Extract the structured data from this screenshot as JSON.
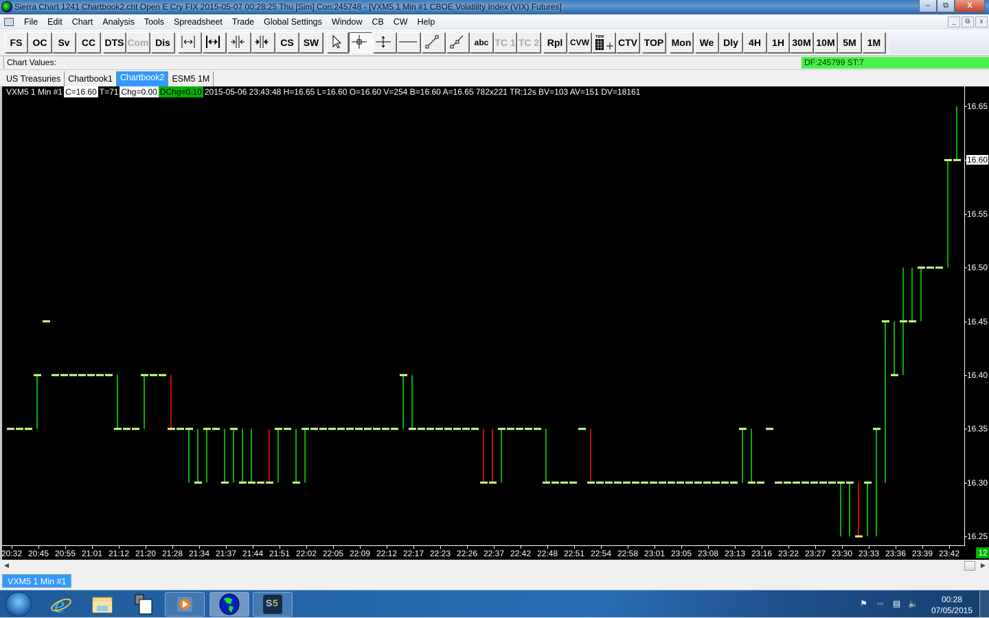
{
  "window": {
    "title": "Sierra Chart 1241 Chartbook2.cht  Open E Cry FIX 2015-05-07  00:28:25 Thu [Sim]  Con:245748 - [VXM5  1 Min   #1  CBOE Volatility Index (VIX) Futures]",
    "minimize": "–",
    "maximize": "⧉",
    "close": "X"
  },
  "menu": [
    "File",
    "Edit",
    "Chart",
    "Analysis",
    "Tools",
    "Spreadsheet",
    "Trade",
    "Global Settings",
    "Window",
    "CB",
    "CW",
    "Help"
  ],
  "mdi": {
    "minimize": "_",
    "restore": "⧉",
    "close": "x"
  },
  "toolbar": {
    "buttons": [
      {
        "label": "FS"
      },
      {
        "label": "OC"
      },
      {
        "label": "Sv"
      },
      {
        "label": "CC"
      },
      {
        "label": "DTS"
      },
      {
        "label": "Com",
        "disabled": true
      },
      {
        "label": "Dis"
      },
      {
        "icon": "scale-left-icon"
      },
      {
        "icon": "scale-both-icon"
      },
      {
        "icon": "compress-in-icon"
      },
      {
        "icon": "compress-out-icon"
      },
      {
        "label": "CS"
      },
      {
        "label": "SW"
      },
      {
        "icon": "pointer-icon"
      },
      {
        "icon": "crosshair-icon",
        "pressed": true
      },
      {
        "icon": "value-tool-icon"
      },
      {
        "icon": "horizontal-line-icon"
      },
      {
        "icon": "line-tool-icon"
      },
      {
        "icon": "ray-tool-icon"
      },
      {
        "label": "abc",
        "small": true
      },
      {
        "label": "TC 1",
        "disabled": true
      },
      {
        "label": "TC 2",
        "disabled": true
      },
      {
        "label": "Rpl"
      },
      {
        "label": "CVW",
        "small": true
      },
      {
        "icon": "trade-window-icon"
      },
      {
        "label": "CTV"
      },
      {
        "label": "TOP"
      },
      {
        "label": "Mon"
      },
      {
        "label": "We"
      },
      {
        "label": "Dly"
      },
      {
        "label": "4H"
      },
      {
        "label": "1H"
      },
      {
        "label": "30M"
      },
      {
        "label": "10M"
      },
      {
        "label": "5M"
      },
      {
        "label": "1M"
      }
    ]
  },
  "chart_values": {
    "label": "Chart Values:",
    "status": "DF:245799  ST:7",
    "status_color": "#4af04a"
  },
  "tabs": [
    {
      "label": "US Treasuries"
    },
    {
      "label": "Chartbook1"
    },
    {
      "label": "Chartbook2",
      "active": true
    },
    {
      "label": "ESM5 1M"
    }
  ],
  "info": {
    "symbol": "VXM5  1 Min   #1",
    "close": "C=16.60",
    "ticks": "T=71",
    "chg": "Chg=0.00",
    "dchg": "DChg=0.10",
    "details": "2015-05-06 23:43:48 H=16.65 L=16.60 O=16.60 V=254 B=16.60 A=16.65 782x221 TR:12s BV=103 AV=151 DV=18161"
  },
  "chart_data": {
    "type": "line",
    "style": "stair-step close line with high/low connectors",
    "colors": {
      "close": "#ccff88",
      "up": "#00ee00",
      "down": "#ff1010",
      "background": "#000000"
    },
    "ylim": [
      16.25,
      16.65
    ],
    "yticks": [
      "16.65",
      "16.60",
      "16.55",
      "16.50",
      "16.45",
      "16.40",
      "16.35",
      "16.30",
      "16.25"
    ],
    "current_price": "16.60",
    "xticks": [
      "20:32",
      "20:45",
      "20:55",
      "21:01",
      "21:12",
      "21:20",
      "21:28",
      "21:34",
      "21:37",
      "21:44",
      "21:51",
      "22:02",
      "22:05",
      "22:09",
      "22:12",
      "22:17",
      "22:23",
      "22:26",
      "22:37",
      "22:42",
      "22:48",
      "22:51",
      "22:54",
      "22:58",
      "23:01",
      "23:05",
      "23:08",
      "23:13",
      "23:16",
      "23:22",
      "23:27",
      "23:30",
      "23:33",
      "23:36",
      "23:39",
      "23:42"
    ],
    "bars": [
      {
        "c": 16.35
      },
      {
        "c": 16.35
      },
      {
        "c": 16.35
      },
      {
        "c": 16.4
      },
      {
        "c": 16.45,
        "nc": true
      },
      {
        "c": 16.4,
        "nc": true
      },
      {
        "c": 16.4
      },
      {
        "c": 16.4
      },
      {
        "c": 16.4
      },
      {
        "c": 16.4
      },
      {
        "c": 16.4
      },
      {
        "c": 16.4
      },
      {
        "c": 16.35
      },
      {
        "c": 16.35
      },
      {
        "c": 16.35
      },
      {
        "c": 16.4
      },
      {
        "c": 16.4
      },
      {
        "c": 16.4
      },
      {
        "c": 16.35,
        "down": true
      },
      {
        "c": 16.35
      },
      {
        "c": 16.35,
        "l": 16.3
      },
      {
        "c": 16.3
      },
      {
        "c": 16.35
      },
      {
        "c": 16.35
      },
      {
        "c": 16.3
      },
      {
        "c": 16.35
      },
      {
        "c": 16.3
      },
      {
        "c": 16.3,
        "h": 16.35
      },
      {
        "c": 16.3
      },
      {
        "c": 16.3,
        "h": 16.35,
        "down": true
      },
      {
        "c": 16.35
      },
      {
        "c": 16.35
      },
      {
        "c": 16.3
      },
      {
        "c": 16.35
      },
      {
        "c": 16.35
      },
      {
        "c": 16.35
      },
      {
        "c": 16.35
      },
      {
        "c": 16.35
      },
      {
        "c": 16.35
      },
      {
        "c": 16.35
      },
      {
        "c": 16.35
      },
      {
        "c": 16.35
      },
      {
        "c": 16.35
      },
      {
        "c": 16.35
      },
      {
        "c": 16.4
      },
      {
        "c": 16.35
      },
      {
        "c": 16.35
      },
      {
        "c": 16.35
      },
      {
        "c": 16.35
      },
      {
        "c": 16.35
      },
      {
        "c": 16.35
      },
      {
        "c": 16.35
      },
      {
        "c": 16.35
      },
      {
        "c": 16.3,
        "down": true
      },
      {
        "c": 16.3,
        "h": 16.35,
        "down": true
      },
      {
        "c": 16.35
      },
      {
        "c": 16.35
      },
      {
        "c": 16.35
      },
      {
        "c": 16.35
      },
      {
        "c": 16.35
      },
      {
        "c": 16.3
      },
      {
        "c": 16.3
      },
      {
        "c": 16.3
      },
      {
        "c": 16.3
      },
      {
        "c": 16.35,
        "nc": true
      },
      {
        "c": 16.3,
        "down": true
      },
      {
        "c": 16.3
      },
      {
        "c": 16.3
      },
      {
        "c": 16.3
      },
      {
        "c": 16.3
      },
      {
        "c": 16.3
      },
      {
        "c": 16.3
      },
      {
        "c": 16.3
      },
      {
        "c": 16.3
      },
      {
        "c": 16.3
      },
      {
        "c": 16.3
      },
      {
        "c": 16.3
      },
      {
        "c": 16.3
      },
      {
        "c": 16.3
      },
      {
        "c": 16.3
      },
      {
        "c": 16.3
      },
      {
        "c": 16.3
      },
      {
        "c": 16.35
      },
      {
        "c": 16.3
      },
      {
        "c": 16.3
      },
      {
        "c": 16.35,
        "nc": true
      },
      {
        "c": 16.3,
        "nc": true
      },
      {
        "c": 16.3
      },
      {
        "c": 16.3
      },
      {
        "c": 16.3
      },
      {
        "c": 16.3
      },
      {
        "c": 16.3
      },
      {
        "c": 16.3
      },
      {
        "c": 16.3,
        "l": 16.25
      },
      {
        "c": 16.3,
        "l": 16.25
      },
      {
        "c": 16.25,
        "down": true
      },
      {
        "c": 16.3
      },
      {
        "c": 16.35,
        "l": 16.25
      },
      {
        "c": 16.45,
        "l": 16.3
      },
      {
        "c": 16.4,
        "h": 16.45
      },
      {
        "c": 16.45,
        "l": 16.4,
        "h": 16.5
      },
      {
        "c": 16.45,
        "h": 16.5
      },
      {
        "c": 16.5
      },
      {
        "c": 16.5
      },
      {
        "c": 16.5
      },
      {
        "c": 16.6
      },
      {
        "c": 16.6,
        "h": 16.65
      }
    ],
    "bar_counter": "12"
  },
  "bottom_tab": "VXM5  1 Min   #1",
  "taskbar": {
    "items": [
      "start-button",
      "internet-explorer",
      "file-explorer",
      "window-switcher",
      "media-player",
      "sierra-chart",
      "s5-trading"
    ],
    "clock_time": "00:28",
    "clock_date": "07/05/2015"
  }
}
